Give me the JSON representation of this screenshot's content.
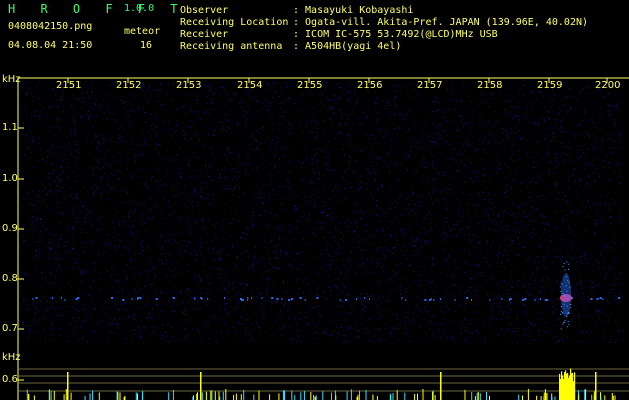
{
  "header": {
    "app_title": "H R O F F T",
    "version": "1.0.0",
    "filename": "0408042150.png",
    "datetime": "04.08.04 21:50",
    "meteor_label": "meteor",
    "meteor_count": "16",
    "observer_label": "Observer",
    "observer_value": ": Masayuki Kobayashi",
    "location_label": "Receiving Location",
    "location_value": ": Ogata-vill. Akita-Pref. JAPAN (139.96E, 40.02N)",
    "receiver_label": "Receiver",
    "receiver_value": ": ICOM IC-575 53.7492(@LCD)MHz USB",
    "antenna_label": "Receiving antenna",
    "antenna_value": ": A504HB(yagi 4el)"
  },
  "axes": {
    "y_unit": "kHz",
    "x_ticks": [
      "2151",
      "2152",
      "2153",
      "2154",
      "2155",
      "2156",
      "2157",
      "2158",
      "2159",
      "2200"
    ],
    "y_ticks": [
      "1.1",
      "1.0",
      "0.9",
      "0.8",
      "0.7",
      "0.6"
    ],
    "y_unit_bottom": "kHz"
  },
  "colors": {
    "text": "#ffff66",
    "title": "#33ff66",
    "background": "#000000",
    "noise": "#1a1aa0",
    "echo_line": "#2a6cff",
    "echo_hot": "#ff3366",
    "bar": "#ffff00",
    "bar_cyan": "#33e0ff"
  }
}
